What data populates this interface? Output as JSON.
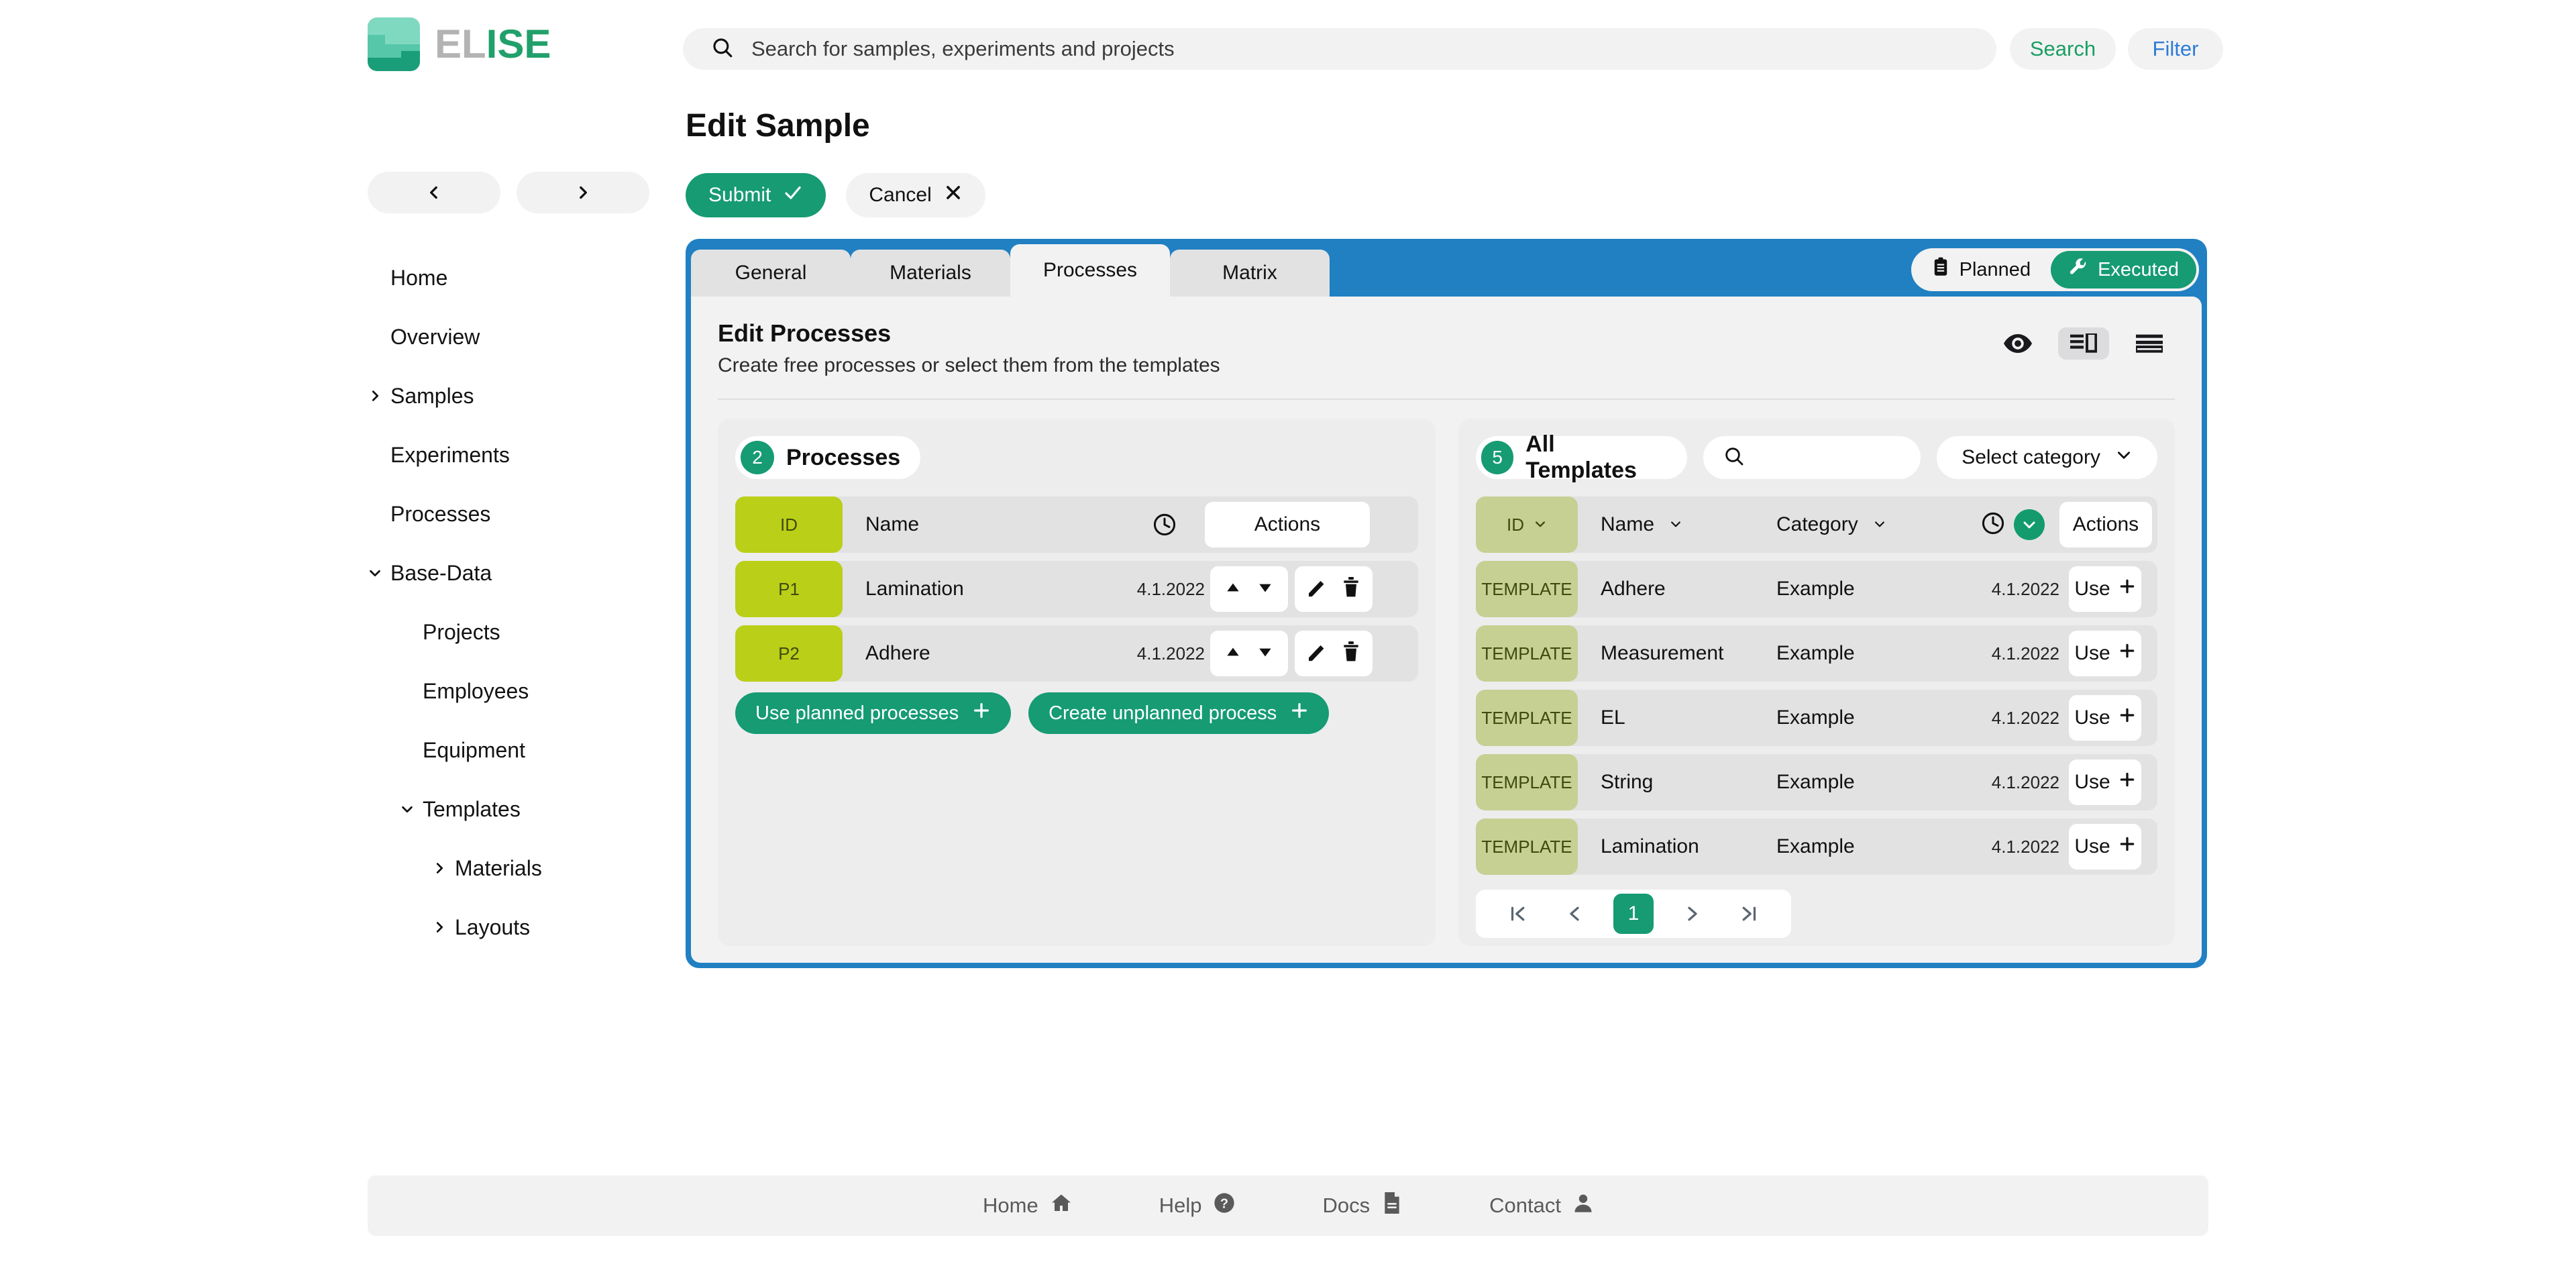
{
  "topbar": {
    "logo_el": "EL",
    "logo_ise": "ISE",
    "search_placeholder": "Search for samples, experiments and projects",
    "search_value": "",
    "search_button": "Search",
    "filter_button": "Filter"
  },
  "sidebar": {
    "prev_icon": "chevron-left-icon",
    "next_icon": "chevron-right-icon",
    "items": [
      {
        "label": "Home",
        "level": 0,
        "caret": "none"
      },
      {
        "label": "Overview",
        "level": 0,
        "caret": "none"
      },
      {
        "label": "Samples",
        "level": 0,
        "caret": "right"
      },
      {
        "label": "Experiments",
        "level": 0,
        "caret": "none"
      },
      {
        "label": "Processes",
        "level": 0,
        "caret": "none"
      },
      {
        "label": "Base-Data",
        "level": 0,
        "caret": "down"
      },
      {
        "label": "Projects",
        "level": 1,
        "caret": "none"
      },
      {
        "label": "Employees",
        "level": 1,
        "caret": "none"
      },
      {
        "label": "Equipment",
        "level": 1,
        "caret": "none"
      },
      {
        "label": "Templates",
        "level": 1,
        "caret": "down"
      },
      {
        "label": "Materials",
        "level": 2,
        "caret": "right"
      },
      {
        "label": "Layouts",
        "level": 2,
        "caret": "right"
      }
    ]
  },
  "page": {
    "title": "Edit Sample",
    "submit_label": "Submit",
    "cancel_label": "Cancel"
  },
  "card": {
    "tabs": [
      {
        "label": "General",
        "active": false
      },
      {
        "label": "Materials",
        "active": false
      },
      {
        "label": "Processes",
        "active": true
      },
      {
        "label": "Matrix",
        "active": false
      }
    ],
    "mode_toggle": {
      "planned_label": "Planned",
      "executed_label": "Executed",
      "selected": "Executed"
    },
    "section_title": "Edit Processes",
    "section_subtitle": "Create free processes or select them from the templates",
    "view_icons": [
      {
        "name": "eye-icon",
        "active": false
      },
      {
        "name": "split-view-icon",
        "active": true
      },
      {
        "name": "list-view-icon",
        "active": false
      }
    ]
  },
  "processes_panel": {
    "count": "2",
    "title": "Processes",
    "columns": {
      "id": "ID",
      "name": "Name",
      "date_icon": "clock-icon",
      "actions": "Actions"
    },
    "rows": [
      {
        "id": "P1",
        "name": "Lamination",
        "date": "4.1.2022"
      },
      {
        "id": "P2",
        "name": "Adhere",
        "date": "4.1.2022"
      }
    ],
    "buttons": [
      {
        "label": "Use planned processes",
        "icon": "plus-icon"
      },
      {
        "label": "Create unplanned process",
        "icon": "plus-icon"
      }
    ],
    "row_icons": {
      "up": "arrow-up-icon",
      "down": "arrow-down-icon",
      "edit": "pencil-icon",
      "delete": "trash-icon"
    }
  },
  "templates_panel": {
    "count": "5",
    "title": "All Templates",
    "search_value": "",
    "category_label": "Select category",
    "columns": {
      "id": "ID",
      "name": "Name",
      "category": "Category",
      "date_icon": "clock-icon",
      "actions": "Actions"
    },
    "rows": [
      {
        "id": "TEMPLATE",
        "name": "Adhere",
        "category": "Example",
        "date": "4.1.2022",
        "action": "Use"
      },
      {
        "id": "TEMPLATE",
        "name": "Measurement",
        "category": "Example",
        "date": "4.1.2022",
        "action": "Use"
      },
      {
        "id": "TEMPLATE",
        "name": "EL",
        "category": "Example",
        "date": "4.1.2022",
        "action": "Use"
      },
      {
        "id": "TEMPLATE",
        "name": "String",
        "category": "Example",
        "date": "4.1.2022",
        "action": "Use"
      },
      {
        "id": "TEMPLATE",
        "name": "Lamination",
        "category": "Example",
        "date": "4.1.2022",
        "action": "Use"
      }
    ],
    "pagination": {
      "current_page": "1",
      "first": "first-page-icon",
      "prev": "prev-page-icon",
      "next": "next-page-icon",
      "last": "last-page-icon"
    }
  },
  "footer": {
    "items": [
      {
        "label": "Home",
        "icon": "home-icon"
      },
      {
        "label": "Help",
        "icon": "question-circle-icon"
      },
      {
        "label": "Docs",
        "icon": "document-icon"
      },
      {
        "label": "Contact",
        "icon": "person-icon"
      }
    ]
  },
  "colors": {
    "brand_green": "#169b73",
    "brand_blue": "#2080c2",
    "id_badge_green": "#bacf18",
    "template_badge": "#c6d093",
    "link_blue": "#2e7cd6",
    "search_green": "#1a9e62"
  }
}
